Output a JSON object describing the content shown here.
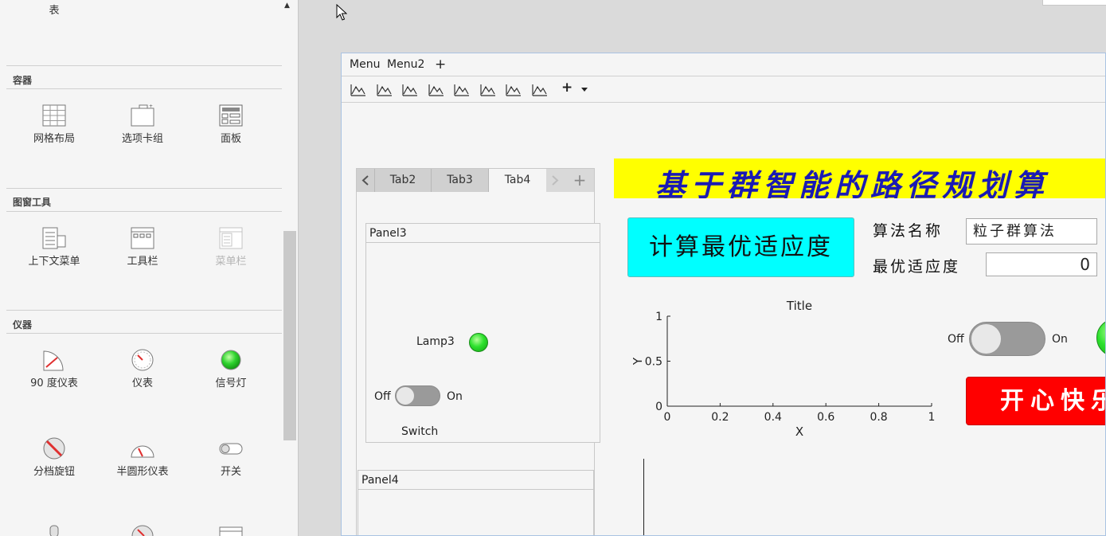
{
  "library": {
    "top_item_label": "表",
    "sections": [
      {
        "title": "容器",
        "items": [
          {
            "label": "网格布局",
            "icon": "grid-layout-icon"
          },
          {
            "label": "选项卡组",
            "icon": "tab-group-icon"
          },
          {
            "label": "面板",
            "icon": "panel-icon"
          }
        ]
      },
      {
        "title": "图窗工具",
        "items": [
          {
            "label": "上下文菜单",
            "icon": "context-menu-icon"
          },
          {
            "label": "工具栏",
            "icon": "toolbar-icon"
          },
          {
            "label": "菜单栏",
            "icon": "menubar-icon",
            "disabled": true
          }
        ]
      },
      {
        "title": "仪器",
        "items": [
          {
            "label": "90 度仪表",
            "icon": "ninety-degree-gauge-icon"
          },
          {
            "label": "仪表",
            "icon": "gauge-icon"
          },
          {
            "label": "信号灯",
            "icon": "lamp-icon"
          },
          {
            "label": "分档旋钮",
            "icon": "discrete-knob-icon"
          },
          {
            "label": "半圆形仪表",
            "icon": "semicircular-gauge-icon"
          },
          {
            "label": "开关",
            "icon": "switch-icon"
          }
        ]
      }
    ]
  },
  "figure": {
    "menubar": {
      "items": [
        "Menu",
        "Menu2"
      ],
      "add_label": "+"
    },
    "toolbar": {
      "push_tool_count": 8,
      "add_label": "+",
      "dropdown_icon": "chevron-down-icon"
    },
    "tabgroup": {
      "tabs": [
        {
          "label": "Tab2",
          "active": false
        },
        {
          "label": "Tab3",
          "active": false
        },
        {
          "label": "Tab4",
          "active": true
        }
      ],
      "add_label": "+",
      "panel3": {
        "title": "Panel3",
        "lamp_label": "Lamp3",
        "switch_off": "Off",
        "switch_on": "On",
        "switch_label": "Switch"
      },
      "panel4": {
        "title": "Panel4"
      }
    },
    "app": {
      "banner_text": "基于群智能的路径规划算",
      "calc_button": "计算最优适应度",
      "algo_label": "算法名称",
      "algo_value": "粒子群算法",
      "fitness_label": "最优适应度",
      "fitness_value": "0",
      "switch_off": "Off",
      "switch_on": "On",
      "red_button": "开心快乐"
    }
  },
  "chart_data": {
    "type": "line",
    "title": "Title",
    "xlabel": "X",
    "ylabel": "Y",
    "xlim": [
      0,
      1
    ],
    "ylim": [
      0,
      1
    ],
    "xticks": [
      "0",
      "0.2",
      "0.4",
      "0.6",
      "0.8",
      "1"
    ],
    "yticks": [
      "0",
      "0.5",
      "1"
    ],
    "series": []
  },
  "colors": {
    "banner_bg": "#ffff00",
    "banner_text": "#1a1ab4",
    "calc_button_bg": "#00ffff",
    "red_button_bg": "#ff0000",
    "lamp": "#2de12d"
  }
}
